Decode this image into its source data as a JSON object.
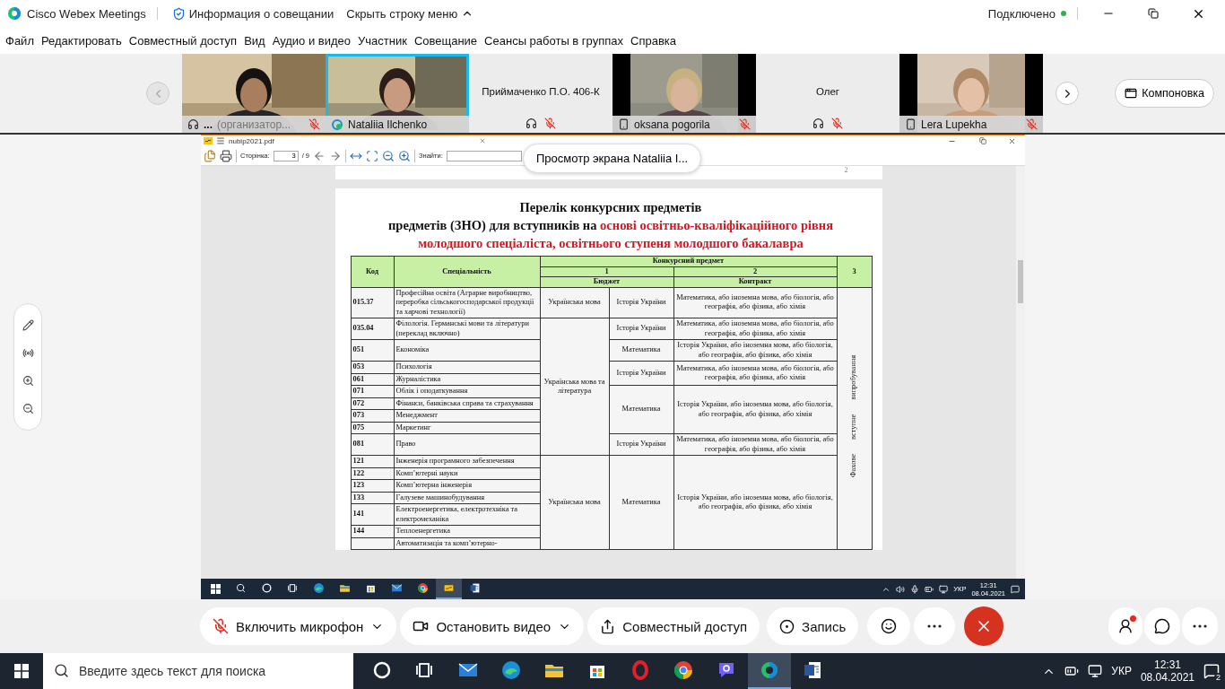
{
  "titlebar": {
    "app": "Cisco Webex Meetings",
    "info": "Информация о совещании",
    "hide_menu": "Скрыть строку меню",
    "status": "Подключено"
  },
  "menu": [
    "Файл",
    "Редактировать",
    "Совместный доступ",
    "Вид",
    "Аудио и видео",
    "Участник",
    "Совещание",
    "Сеансы работы в группах",
    "Справка"
  ],
  "participants": [
    {
      "kind": "video",
      "name": "...",
      "role": "(организатор...",
      "audio": {
        "kind": "headset"
      },
      "muted": true,
      "selected": false
    },
    {
      "kind": "video",
      "name": "Nataliia Ilchenko",
      "audio": {
        "kind": "computer"
      },
      "muted": false,
      "selected": true
    },
    {
      "kind": "no_video",
      "name": "Приймаченко П.О. 406-К",
      "audio": {
        "kind": "headset"
      },
      "muted": true,
      "selected": false
    },
    {
      "kind": "video",
      "name": "oksana pogorila",
      "audio": {
        "kind": "phone"
      },
      "muted": true,
      "selected": false
    },
    {
      "kind": "no_video",
      "name": "Олег",
      "audio": {
        "kind": "headset"
      },
      "muted": true,
      "selected": false
    },
    {
      "kind": "video",
      "name": "Lera Lupekha",
      "audio": {
        "kind": "phone"
      },
      "muted": true,
      "selected": false
    }
  ],
  "layout_button": "Компоновка",
  "share_badge": "Просмотр экрана Nataliia I...",
  "viewer": {
    "file": "nubip2021.pdf",
    "page_label": "Сторінка:",
    "page": "3",
    "pages": "/ 9",
    "find_label": "Знайти:",
    "prev_page_number": "2",
    "title": "Перелік конкурсних предметів",
    "subtitle_lead": "предметів (ЗНО) для вступників на",
    "subtitle_highlight": [
      "основі освітньо-кваліфікаційного рівня",
      "молодшого спеціаліста, освітнього ступеня молодшого бакалавра"
    ],
    "table": {
      "header": {
        "code": "Код",
        "specialty": "Спеціальність",
        "group": "Конкурсний предмет",
        "number_1": "1",
        "number_2": "2",
        "number_3": "3",
        "budget": "Бюджет",
        "contract": "Контракт"
      },
      "side_label": "Фахове вступне випробування",
      "blocks": [
        {
          "budget": "Українська мова",
          "groups": [
            {
              "subject": "Історія України",
              "contract": "Математика, або іноземна мова, або біологія, або географія, або фізика, або хімія",
              "rows": [
                {
                  "code": "015.37",
                  "specialty": "Професійна освіта (Аграрне виробництво, переробка сільськогосподарської продукції та харчові технології)"
                }
              ]
            }
          ]
        },
        {
          "budget": "Українська мова та література",
          "groups": [
            {
              "subject": "Історія України",
              "contract": "Математика, або іноземна мова, або біологія, або географія, або фізика, або хімія",
              "rows": [
                {
                  "code": "035.04",
                  "specialty": "Філологія. Германські мови та літератури (переклад включно)"
                }
              ]
            },
            {
              "subject": "Математика",
              "contract": "Історія України, або іноземна мова, або біологія, або географія, або фізика, або хімія",
              "rows": [
                {
                  "code": "051",
                  "specialty": "Економіка"
                }
              ]
            },
            {
              "subject": "Історія України",
              "contract": "Математика, або іноземна мова, або біологія, або географія, або фізика, або хімія",
              "rows": [
                {
                  "code": "053",
                  "specialty": "Психологія"
                },
                {
                  "code": "061",
                  "specialty": "Журналістика"
                }
              ]
            },
            {
              "subject": "Математика",
              "contract": "Історія України, або іноземна мова, або біологія, або географія, або фізика, або хімія",
              "rows": [
                {
                  "code": "071",
                  "specialty": "Облік і оподаткування"
                },
                {
                  "code": "072",
                  "specialty": "Фінанси, банківська справа та страхування"
                },
                {
                  "code": "073",
                  "specialty": "Менеджмент"
                },
                {
                  "code": "075",
                  "specialty": "Маркетинг"
                }
              ]
            },
            {
              "subject": "Історія України",
              "contract": "Математика, або іноземна мова, або біологія, або географія, або фізика, або хімія",
              "rows": [
                {
                  "code": "081",
                  "specialty": "Право"
                }
              ]
            }
          ]
        },
        {
          "budget": "Українська мова",
          "groups": [
            {
              "subject": "Математика",
              "contract": "Історія України, або іноземна мова, або біологія, або географія, або фізика, або хімія",
              "rows": [
                {
                  "code": "121",
                  "specialty": "Інженерія програмного забезпечення"
                },
                {
                  "code": "122",
                  "specialty": "Комп’ютерні науки"
                },
                {
                  "code": "123",
                  "specialty": "Комп’ютерна інженерія"
                },
                {
                  "code": "133",
                  "specialty": "Галузеве машинобудування"
                },
                {
                  "code": "141",
                  "specialty": "Електроенергетика, електротехніка та електромеханіка"
                },
                {
                  "code": "144",
                  "specialty": "Теплоенергетика"
                },
                {
                  "specialty": "Автоматизація та комп’ютерно-"
                }
              ]
            }
          ]
        }
      ]
    },
    "taskbar": {
      "apps": [
        {
          "kind": "cortana",
          "selected": false
        },
        {
          "kind": "taskview",
          "selected": false
        },
        {
          "kind": "edge",
          "selected": false
        },
        {
          "kind": "folder",
          "selected": false
        },
        {
          "kind": "store",
          "selected": false
        },
        {
          "kind": "mail",
          "selected": false
        },
        {
          "kind": "chrome",
          "selected": false
        },
        {
          "kind": "foxit",
          "selected": true
        },
        {
          "kind": "word",
          "selected": false
        }
      ],
      "lang": "УКР",
      "time": "12:31",
      "date": "08.04.2021"
    }
  },
  "controls": {
    "mic": "Включить микрофон",
    "video": "Остановить видео",
    "share": "Совместный доступ",
    "record": "Запись",
    "participants_alert": true
  },
  "taskbar": {
    "search_placeholder": "Введите здесь текст для поиска",
    "apps": [
      {
        "kind": "cortana",
        "selected": false
      },
      {
        "kind": "taskview",
        "selected": false
      },
      {
        "kind": "mail",
        "selected": false
      },
      {
        "kind": "edge",
        "selected": false
      },
      {
        "kind": "folder",
        "selected": false
      },
      {
        "kind": "store",
        "selected": false
      },
      {
        "kind": "opera",
        "selected": false
      },
      {
        "kind": "chrome",
        "selected": false
      },
      {
        "kind": "viber",
        "selected": false
      },
      {
        "kind": "webex",
        "selected": true
      },
      {
        "kind": "word",
        "selected": false
      }
    ],
    "lang": "УКР",
    "time": "12:31",
    "date": "08.04.2021",
    "notifications": "2"
  }
}
